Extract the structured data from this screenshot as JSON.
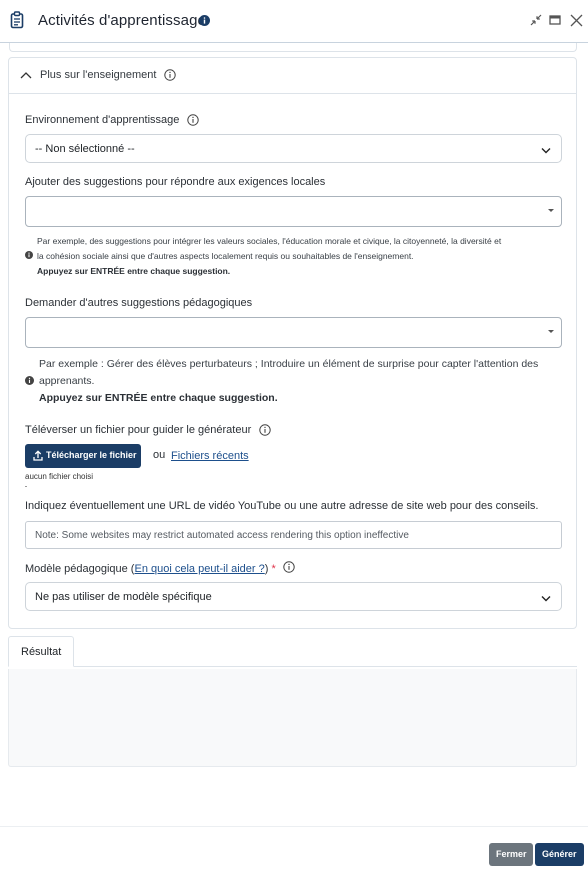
{
  "header": {
    "title": "Activités d'apprentissage"
  },
  "section": {
    "title": "Plus sur l'enseignement"
  },
  "learning_env": {
    "label": "Environnement d'apprentissage",
    "value": "-- Non sélectionné --"
  },
  "local_suggestions": {
    "label": "Ajouter des suggestions pour répondre aux exigences locales",
    "help_line1": "Par exemple, des suggestions pour intégrer les valeurs sociales, l'éducation morale et civique, la citoyenneté, la diversité et",
    "help_line2": "la cohésion sociale ainsi que d'autres aspects localement requis ou souhaitables de l'enseignement.",
    "help_line3": "Appuyez sur ENTRÉE entre chaque suggestion."
  },
  "pedagogical_suggestions": {
    "label": "Demander d'autres suggestions pédagogiques",
    "help_line1": "Par exemple : Gérer des élèves perturbateurs ; Introduire un élément de surprise pour capter l'attention des",
    "help_line2": "apprenants.",
    "help_line3": "Appuyez sur ENTRÉE entre chaque suggestion."
  },
  "upload": {
    "label": "Téléverser un fichier pour guider le générateur",
    "button_label": "Télécharger le fichier",
    "or_text": "ou",
    "recent_link": "Fichiers récents",
    "no_file": "aucun fichier choisi"
  },
  "url_input": {
    "label": "Indiquez éventuellement une URL de vidéo YouTube ou une autre adresse de site web pour des conseils.",
    "placeholder": "Note: Some websites may restrict automated access rendering this option ineffective"
  },
  "model": {
    "label_prefix": "Modèle pédagogique (",
    "help_link": "En quoi cela peut-il aider ?",
    "label_suffix": ")",
    "required_mark": "*",
    "value": "Ne pas utiliser de modèle spécifique"
  },
  "result_tab": {
    "label": "Résultat"
  },
  "footer": {
    "close_label": "Fermer",
    "generate_label": "Générer"
  },
  "colors": {
    "primary": "#1b3d66",
    "secondary": "#6c757d",
    "link": "#1d4f8c",
    "required": "#e0344b"
  }
}
